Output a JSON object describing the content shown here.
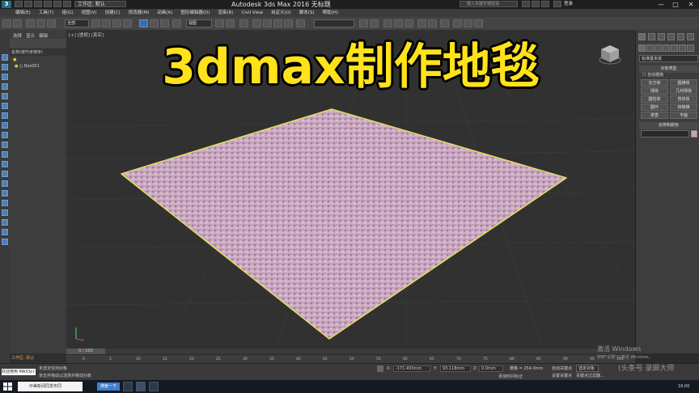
{
  "titlebar": {
    "workspace_label": "工作区: 默认",
    "app_title": "Autodesk 3ds Max 2016    无标题",
    "search_placeholder": "键入关键字或短语",
    "login_label": "登录",
    "minimize": "—",
    "maximize": "□",
    "close": "✕"
  },
  "menu": [
    "编辑(E)",
    "工具(T)",
    "组(G)",
    "视图(V)",
    "创建(C)",
    "修改器(M)",
    "动画(A)",
    "图形编辑器(D)",
    "渲染(R)",
    "Civil View",
    "自定义(U)",
    "脚本(S)",
    "帮助(H)"
  ],
  "toolbar": {
    "filter_value": "全部",
    "view_value": "视图"
  },
  "explorer": {
    "tabs": [
      "选择",
      "显示",
      "编辑"
    ],
    "header": "名称(按升序排序)",
    "rows": [
      "",
      "Box001"
    ],
    "footer": "工作区: 默认"
  },
  "viewport": {
    "label": "[+] [透视] [真实]",
    "headline": "3dmax制作地毯",
    "carpet_color": "#c8a6be"
  },
  "command_panel": {
    "category": "标准基本体",
    "rollout_object_type": "对象类型",
    "autogrid_label": "自动栅格",
    "primitives": [
      "长方体",
      "圆锥体",
      "球体",
      "几何球体",
      "圆柱体",
      "管状体",
      "圆环",
      "四棱锥",
      "茶壶",
      "平面"
    ],
    "rollout_name_color": "名称和颜色"
  },
  "timeline": {
    "slider": "0 / 100",
    "ticks": [
      "0",
      "5",
      "10",
      "15",
      "20",
      "25",
      "30",
      "35",
      "40",
      "45",
      "50",
      "55",
      "60",
      "65",
      "70",
      "75",
      "80",
      "85",
      "90",
      "95",
      "100"
    ]
  },
  "statusbar": {
    "left_top": "欢迎使用 MAXScr",
    "msg1": "未选定任何对象",
    "msg2": "单击并拖动以选择并移动对象",
    "x_value": "-171.493mm",
    "y_value": "93.118mm",
    "z_value": "0.0mm",
    "grid": "栅格 = 254.0mm",
    "add_time_tag": "添加时间标记",
    "auto_key": "自动关键点",
    "selected_label": "选定对象",
    "set_key": "设置关键点",
    "key_filter": "关键点过滤器...",
    "activate": "激活 Windows",
    "activate_sub": "转到\"设置\"以激活 Windows。"
  },
  "taskbar": {
    "search_text": "中美新闻同发布同",
    "chip_label": "搜索一下",
    "time": "16:00"
  },
  "watermark": "(头条号 录屏大师"
}
